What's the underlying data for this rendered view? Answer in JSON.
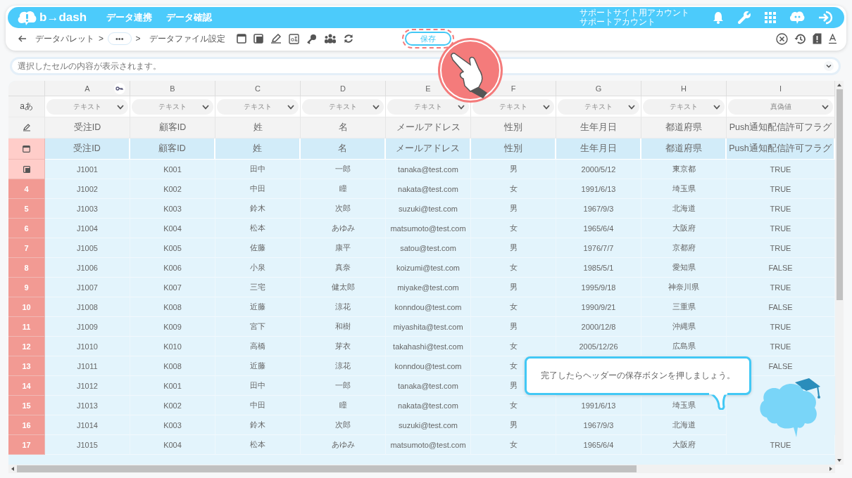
{
  "header": {
    "logo": "b→dash",
    "nav": [
      {
        "label": "データ連携"
      },
      {
        "label": "データ確認"
      }
    ],
    "account": {
      "site": "サポートサイト用アカウント",
      "user": "サポートアカウント"
    }
  },
  "toolbar": {
    "breadcrumb": {
      "separator": ">",
      "items": [
        {
          "label": "データパレット",
          "kind": "link"
        },
        {
          "label": "•••",
          "kind": "more"
        },
        {
          "label": "データファイル設定",
          "kind": "current"
        }
      ]
    },
    "save": "保存",
    "save_highlighted": true
  },
  "formula_bar": {
    "placeholder": "選択したセルの内容が表示されます。"
  },
  "table": {
    "columns": [
      {
        "label": "A",
        "key": true
      },
      {
        "label": "B",
        "key": false
      },
      {
        "label": "C",
        "key": false
      },
      {
        "label": "D",
        "key": false
      },
      {
        "label": "E",
        "key": false
      },
      {
        "label": "F",
        "key": false
      },
      {
        "label": "G",
        "key": false
      },
      {
        "label": "H",
        "key": false
      },
      {
        "label": "I",
        "key": false
      }
    ],
    "type_row_label": "aあ",
    "types": [
      "テキスト",
      "テキスト",
      "テキスト",
      "テキスト",
      "テキスト",
      "テキスト",
      "テキスト",
      "テキスト",
      "真偽値"
    ],
    "names": [
      "受注ID",
      "顧客ID",
      "姓",
      "名",
      "メールアドレス",
      "性別",
      "生年月日",
      "都道府県",
      "Push通知配信許可フラグ"
    ],
    "header_row": [
      "受注ID",
      "顧客ID",
      "姓",
      "名",
      "メールアドレス",
      "性別",
      "生年月日",
      "都道府県",
      "Push通知配信許可フラグ"
    ],
    "rows": [
      {
        "cells": [
          "J1001",
          "K001",
          "田中",
          "一郎",
          "tanaka@test.com",
          "男",
          "2000/5/12",
          "東京都",
          "TRUE"
        ]
      },
      {
        "number": "4",
        "cells": [
          "J1002",
          "K002",
          "中田",
          "瞳",
          "nakata@test.com",
          "女",
          "1991/6/13",
          "埼玉県",
          "TRUE"
        ]
      },
      {
        "number": "5",
        "cells": [
          "J1003",
          "K003",
          "鈴木",
          "次郎",
          "suzuki@test.com",
          "男",
          "1967/9/3",
          "北海道",
          "TRUE"
        ]
      },
      {
        "number": "6",
        "cells": [
          "J1004",
          "K004",
          "松本",
          "あゆみ",
          "matsumoto@test.com",
          "女",
          "1965/6/4",
          "大阪府",
          "TRUE"
        ]
      },
      {
        "number": "7",
        "cells": [
          "J1005",
          "K005",
          "佐藤",
          "康平",
          "satou@test.com",
          "男",
          "1976/7/7",
          "京都府",
          "TRUE"
        ]
      },
      {
        "number": "8",
        "cells": [
          "J1006",
          "K006",
          "小泉",
          "真奈",
          "koizumi@test.com",
          "女",
          "1985/5/1",
          "愛知県",
          "FALSE"
        ]
      },
      {
        "number": "9",
        "cells": [
          "J1007",
          "K007",
          "三宅",
          "健太郎",
          "miyake@test.com",
          "男",
          "1995/9/18",
          "神奈川県",
          "TRUE"
        ]
      },
      {
        "number": "10",
        "cells": [
          "J1008",
          "K008",
          "近藤",
          "涼花",
          "konndou@test.com",
          "女",
          "1990/9/21",
          "三重県",
          "FALSE"
        ]
      },
      {
        "number": "11",
        "cells": [
          "J1009",
          "K009",
          "宮下",
          "和樹",
          "miyashita@test.com",
          "男",
          "2000/12/8",
          "沖縄県",
          "TRUE"
        ]
      },
      {
        "number": "12",
        "cells": [
          "J1010",
          "K010",
          "高橋",
          "芽衣",
          "takahashi@test.com",
          "女",
          "2005/12/26",
          "広島県",
          "TRUE"
        ]
      },
      {
        "number": "13",
        "cells": [
          "J1011",
          "K008",
          "近藤",
          "涼花",
          "konndou@test.com",
          "女",
          null,
          null,
          "FALSE"
        ]
      },
      {
        "number": "14",
        "cells": [
          "J1012",
          "K001",
          "田中",
          "一郎",
          "tanaka@test.com",
          "男",
          null,
          null,
          null
        ]
      },
      {
        "number": "15",
        "cells": [
          "J1013",
          "K002",
          "中田",
          "瞳",
          "nakata@test.com",
          "女",
          "1991/6/13",
          "埼玉県",
          null
        ]
      },
      {
        "number": "16",
        "cells": [
          "J1014",
          "K003",
          "鈴木",
          "次郎",
          "suzuki@test.com",
          "男",
          "1967/9/3",
          "北海道",
          null
        ]
      },
      {
        "number": "17",
        "cells": [
          "J1015",
          "K004",
          "松本",
          "あゆみ",
          "matsumoto@test.com",
          "女",
          "1965/6/4",
          "大阪府",
          "TRUE"
        ]
      }
    ]
  },
  "tip": {
    "text": "完了したらヘッダーの保存ボタンを押しましょう。"
  }
}
